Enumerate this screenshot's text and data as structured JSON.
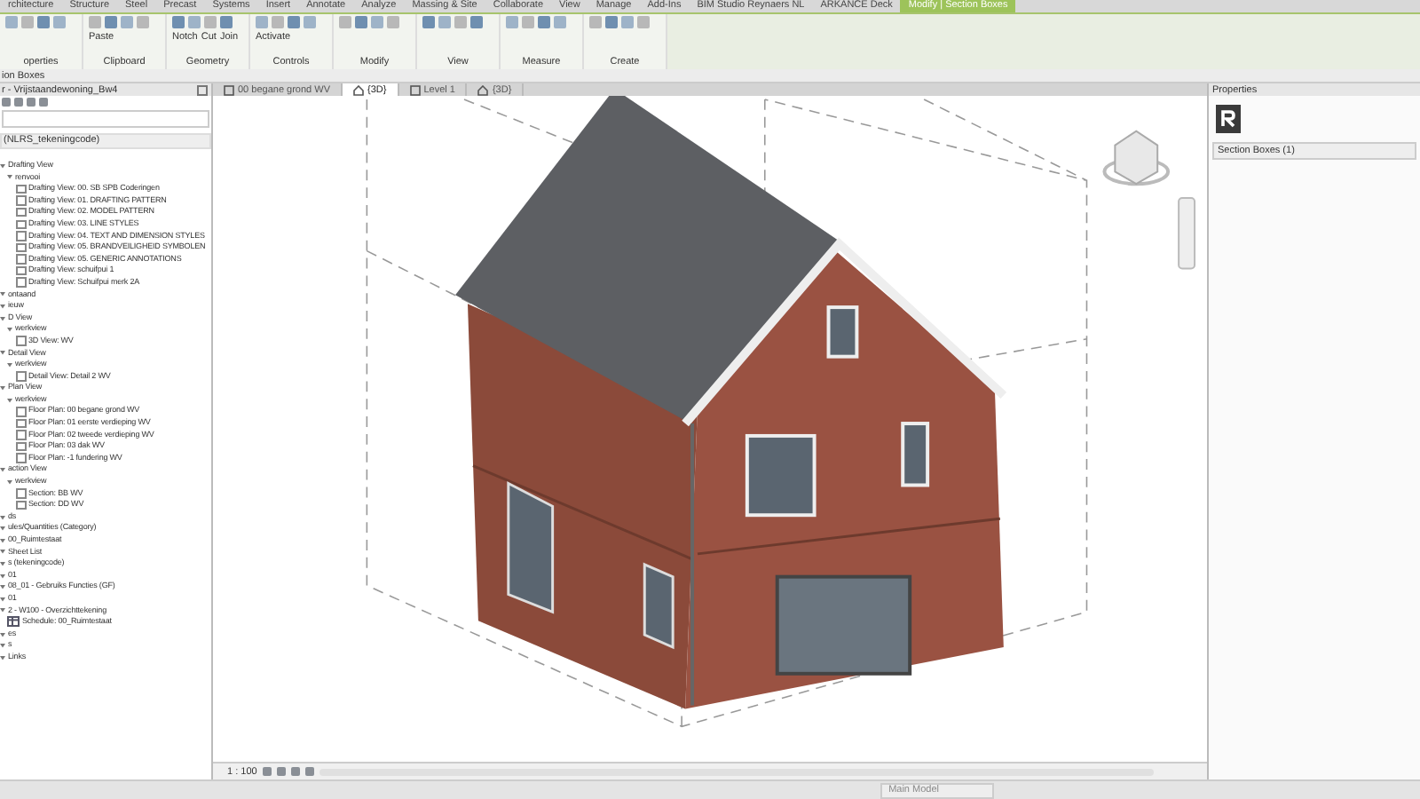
{
  "ribbon": {
    "tabs": [
      {
        "label": "rchitecture",
        "selected": false
      },
      {
        "label": "Structure",
        "selected": false
      },
      {
        "label": "Steel",
        "selected": false
      },
      {
        "label": "Precast",
        "selected": false
      },
      {
        "label": "Systems",
        "selected": false
      },
      {
        "label": "Insert",
        "selected": false
      },
      {
        "label": "Annotate",
        "selected": false
      },
      {
        "label": "Analyze",
        "selected": false
      },
      {
        "label": "Massing & Site",
        "selected": false
      },
      {
        "label": "Collaborate",
        "selected": false
      },
      {
        "label": "View",
        "selected": false
      },
      {
        "label": "Manage",
        "selected": false
      },
      {
        "label": "Add-Ins",
        "selected": false
      },
      {
        "label": "BIM Studio Reynaers NL",
        "selected": false
      },
      {
        "label": "ARKANCE Deck",
        "selected": false
      },
      {
        "label": "Modify | Section Boxes",
        "selected": true
      }
    ],
    "panels": [
      {
        "label": "operties"
      },
      {
        "label": "Clipboard",
        "tools": [
          "Paste"
        ]
      },
      {
        "label": "Geometry",
        "tools": [
          "Notch",
          "Cut",
          "Join"
        ]
      },
      {
        "label": "Controls",
        "tools": [
          "Activate"
        ]
      },
      {
        "label": "Modify"
      },
      {
        "label": "View"
      },
      {
        "label": "Measure"
      },
      {
        "label": "Create"
      }
    ]
  },
  "options_bar": {
    "label": "ion Boxes"
  },
  "project_browser": {
    "title": "r - Vrijstaandewoning_Bw4",
    "filter": "(NLRS_tekeningcode)",
    "tree": [
      {
        "label": "Drafting View",
        "kind": "group",
        "children": [
          {
            "label": "renvooi",
            "kind": "group",
            "children": [
              {
                "label": "Drafting View: 00. SB SPB Coderingen",
                "kind": "view"
              },
              {
                "label": "Drafting View: 01. DRAFTING PATTERN",
                "kind": "view"
              },
              {
                "label": "Drafting View: 02. MODEL PATTERN",
                "kind": "view"
              },
              {
                "label": "Drafting View: 03. LINE STYLES",
                "kind": "view"
              },
              {
                "label": "Drafting View: 04. TEXT AND DIMENSION STYLES",
                "kind": "view"
              },
              {
                "label": "Drafting View: 05. BRANDVEILIGHEID SYMBOLEN",
                "kind": "view"
              },
              {
                "label": "Drafting View: 05. GENERIC ANNOTATIONS",
                "kind": "view"
              },
              {
                "label": "Drafting View: schuifpui 1",
                "kind": "view"
              },
              {
                "label": "Drafting View: Schuifpui merk 2A",
                "kind": "view"
              }
            ]
          }
        ]
      },
      {
        "label": "ontaand",
        "kind": "group"
      },
      {
        "label": "ieuw",
        "kind": "group"
      },
      {
        "label": "D View",
        "kind": "group",
        "children": [
          {
            "label": "werkview",
            "kind": "group",
            "children": [
              {
                "label": "3D View: WV",
                "kind": "view"
              }
            ]
          }
        ]
      },
      {
        "label": "Detail View",
        "kind": "group",
        "children": [
          {
            "label": "werkview",
            "kind": "group",
            "children": [
              {
                "label": "Detail View: Detail 2 WV",
                "kind": "view"
              }
            ]
          }
        ]
      },
      {
        "label": "Plan View",
        "kind": "group",
        "children": [
          {
            "label": "werkview",
            "kind": "group",
            "children": [
              {
                "label": "Floor Plan: 00 begane grond WV",
                "kind": "view"
              },
              {
                "label": "Floor Plan: 01 eerste verdieping WV",
                "kind": "view"
              },
              {
                "label": "Floor Plan: 02 tweede verdieping WV",
                "kind": "view"
              },
              {
                "label": "Floor Plan: 03 dak WV",
                "kind": "view"
              },
              {
                "label": "Floor Plan: -1 fundering WV",
                "kind": "view"
              }
            ]
          }
        ]
      },
      {
        "label": "action View",
        "kind": "group",
        "children": [
          {
            "label": "werkview",
            "kind": "group",
            "children": [
              {
                "label": "Section: BB WV",
                "kind": "view"
              },
              {
                "label": "Section: DD WV",
                "kind": "view"
              }
            ]
          }
        ]
      },
      {
        "label": "ds",
        "kind": "group"
      },
      {
        "label": "ules/Quantities (Category)",
        "kind": "group"
      },
      {
        "label": "00_Ruimtestaat",
        "kind": "group"
      },
      {
        "label": "Sheet List",
        "kind": "group"
      },
      {
        "label": "s (tekeningcode)",
        "kind": "group"
      },
      {
        "label": "01",
        "kind": "group"
      },
      {
        "label": "08_01 - Gebruiks Functies (GF)",
        "kind": "group"
      },
      {
        "label": "01",
        "kind": "group"
      },
      {
        "label": "2 - W100 - Overzichttekening",
        "kind": "group",
        "children": [
          {
            "label": "Schedule: 00_Ruimtestaat",
            "kind": "schedule"
          }
        ]
      },
      {
        "label": "es",
        "kind": "group"
      },
      {
        "label": "s",
        "kind": "group"
      },
      {
        "label": "Links",
        "kind": "group"
      }
    ]
  },
  "view_tabs": [
    {
      "label": "00 begane grond WV",
      "kind": "plan",
      "selected": false
    },
    {
      "label": "{3D}",
      "kind": "model",
      "selected": true
    },
    {
      "label": "Level 1",
      "kind": "plan",
      "selected": false
    },
    {
      "label": "{3D}",
      "kind": "model",
      "selected": false
    }
  ],
  "view_control_bar": {
    "scale": "1 : 100"
  },
  "properties": {
    "title": "Properties",
    "type_selector": "Section Boxes (1)"
  },
  "status_bar": {
    "model": "Main Model"
  }
}
